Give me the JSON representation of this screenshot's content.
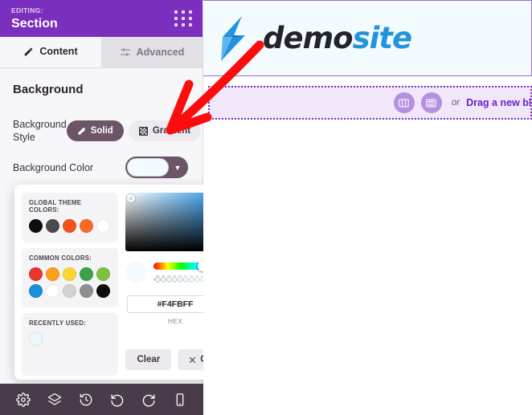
{
  "sidebar": {
    "header": {
      "editing_label": "EDITING:",
      "section_name": "Section",
      "grid_icon": "grid-dots-icon"
    },
    "tabs": [
      {
        "label": "Content",
        "icon": "pencil-icon",
        "active": true
      },
      {
        "label": "Advanced",
        "icon": "sliders-icon",
        "active": false
      }
    ],
    "background": {
      "title": "Background",
      "style_label": "Background Style",
      "style_options": [
        {
          "label": "Solid",
          "icon": "eyedropper-icon",
          "selected": true
        },
        {
          "label": "Gradient",
          "icon": "gradient-grid-icon",
          "selected": false
        }
      ],
      "color_label": "Background Color",
      "color_value": "#F4FBFF",
      "color_chevron": "chevron-down-icon"
    }
  },
  "color_picker": {
    "global_theme": {
      "caption": "GLOBAL THEME COLORS:",
      "colors": [
        "#0d0d0d",
        "#4a4a4a",
        "#f4511e",
        "#fb6a28",
        "#ffffff"
      ]
    },
    "common": {
      "caption": "COMMON COLORS:",
      "row1": [
        "#e8352e",
        "#f99f1c",
        "#fbd436",
        "#3da14a",
        "#7cc242"
      ],
      "row2": [
        "#1b8ede",
        "#ffffff",
        "#d2d2d2",
        "#8f8f8f",
        "#0d0d0d"
      ]
    },
    "recently_used": {
      "caption": "RECENTLY USED:",
      "colors": [
        "#eef7fd"
      ]
    },
    "hex_value": "#F4FBFF",
    "hex_caption": "HEX",
    "preview_color": "#f4fbff",
    "hue_position_pct": 57,
    "alpha_position_pct": 100,
    "buttons": [
      {
        "label": "Clear",
        "icon": ""
      },
      {
        "label": "Close",
        "icon": "close-x-icon"
      }
    ]
  },
  "bottom_bar": {
    "icons": [
      "gear-icon",
      "layers-icon",
      "history-icon",
      "undo-icon",
      "redo-icon",
      "mobile-icon"
    ]
  },
  "canvas": {
    "logo": {
      "icon": "lightning-bolt-icon",
      "text_dark": "demo",
      "text_blue": "site"
    },
    "dropzone": {
      "btn_columns_icon": "columns-icon",
      "btn_block_icon": "block-layout-icon",
      "or_text": "or",
      "message": "Drag a new block h"
    }
  },
  "annotation": {
    "type": "red-arrow",
    "color": "#fb0d0d"
  }
}
